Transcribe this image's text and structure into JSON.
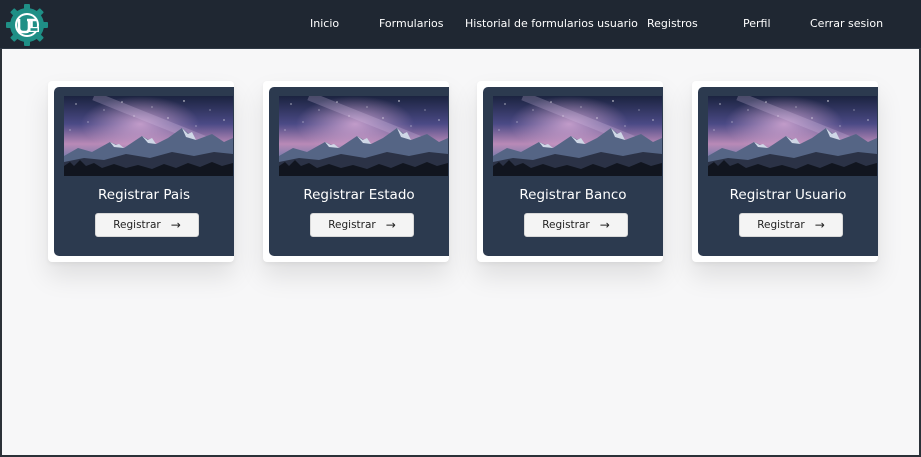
{
  "navbar": {
    "logo_icon": "utesc-gear-logo-icon",
    "links": [
      {
        "label": "Inicio"
      },
      {
        "label": "Formularios"
      },
      {
        "label": "Historial de formularios usuario"
      },
      {
        "label": "Registros"
      },
      {
        "label": "Perfil"
      },
      {
        "label": "Cerrar sesion"
      }
    ]
  },
  "cards": [
    {
      "title": "Registrar Pais",
      "button_label": "Registrar",
      "arrow": "→"
    },
    {
      "title": "Registrar Estado",
      "button_label": "Registrar",
      "arrow": "→"
    },
    {
      "title": "Registrar Banco",
      "button_label": "Registrar",
      "arrow": "→"
    },
    {
      "title": "Registrar Usuario",
      "button_label": "Registrar",
      "arrow": "→"
    }
  ],
  "colors": {
    "navbar_bg": "#1f2732",
    "card_bg": "#2c3a4f",
    "logo_teal": "#1f8f86",
    "page_bg": "#f7f7f8"
  }
}
